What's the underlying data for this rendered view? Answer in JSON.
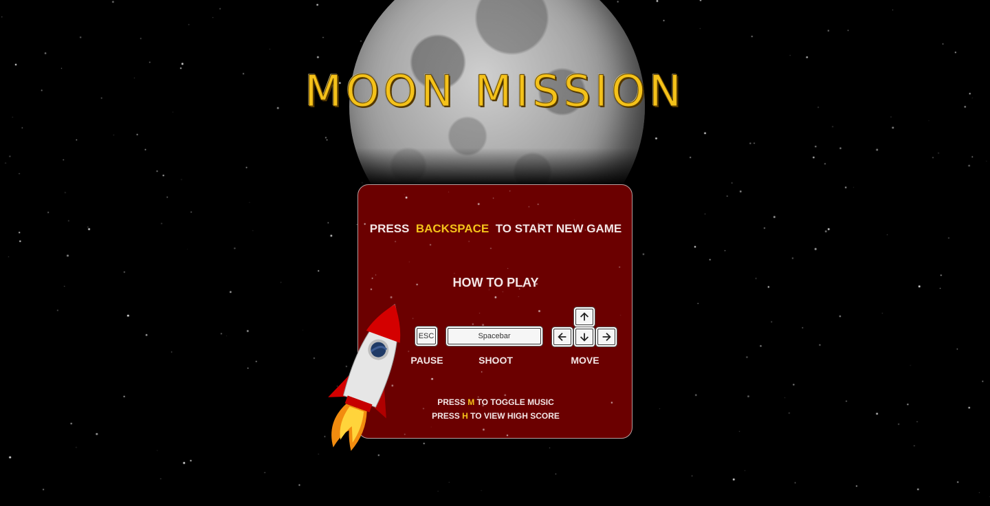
{
  "title": "MOON MISSION",
  "start": {
    "prefix": "PRESS",
    "key": "BACKSPACE",
    "suffix": "TO START NEW GAME"
  },
  "how_to_play": "HOW TO PLAY",
  "keys": {
    "esc": "ESC",
    "spacebar": "Spacebar"
  },
  "labels": {
    "pause": "PAUSE",
    "shoot": "SHOOT",
    "move": "MOVE"
  },
  "hints": [
    {
      "prefix": "PRESS",
      "key": "M",
      "suffix": "TO TOGGLE MUSIC"
    },
    {
      "prefix": "PRESS",
      "key": "H",
      "suffix": "TO VIEW HIGH SCORE"
    }
  ],
  "colors": {
    "highlight": "#f4c21a",
    "panel": "#6b0000",
    "text": "#f3e6e6"
  },
  "icons": [
    "arrow-up-icon",
    "arrow-left-icon",
    "arrow-down-icon",
    "arrow-right-icon",
    "rocket-icon",
    "moon-image"
  ]
}
